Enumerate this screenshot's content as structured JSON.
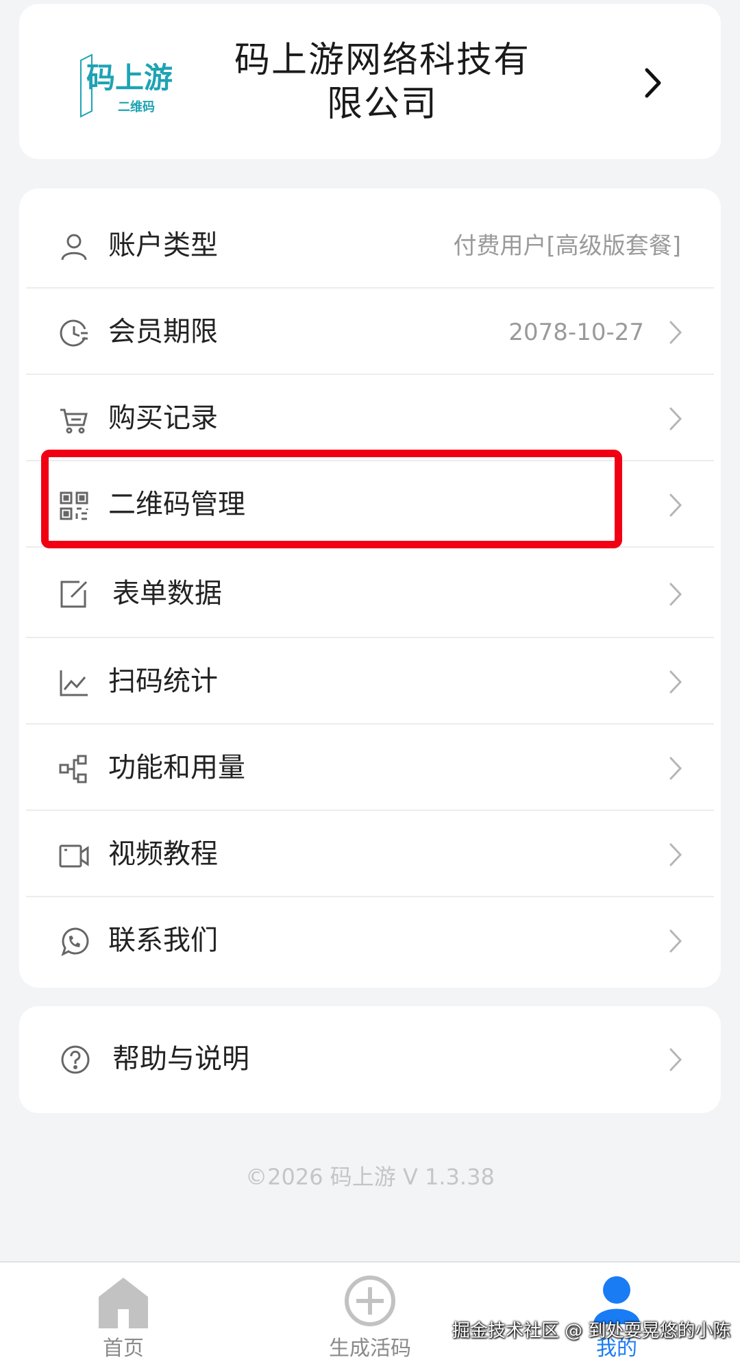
{
  "company": {
    "logo_text": "码上游",
    "logo_subtext": "二维码",
    "name_line1": "码上游网络科技有",
    "name_line2": "限公司"
  },
  "menu": [
    {
      "id": "account-type",
      "icon": "user-icon",
      "label": "账户类型",
      "value": "付费用户[高级版套餐]",
      "chevron": false
    },
    {
      "id": "membership",
      "icon": "clock-icon",
      "label": "会员期限",
      "value": "2078-10-27",
      "chevron": true
    },
    {
      "id": "purchases",
      "icon": "cart-icon",
      "label": "购买记录",
      "value": "",
      "chevron": true
    },
    {
      "id": "qrcode-manage",
      "icon": "qrcode-icon",
      "label": "二维码管理",
      "value": "",
      "chevron": true
    },
    {
      "id": "form-data",
      "icon": "edit-icon",
      "label": "表单数据",
      "value": "",
      "chevron": true
    },
    {
      "id": "scan-stats",
      "icon": "chart-icon",
      "label": "扫码统计",
      "value": "",
      "chevron": true
    },
    {
      "id": "features",
      "icon": "diagram-icon",
      "label": "功能和用量",
      "value": "",
      "chevron": true
    },
    {
      "id": "tutorials",
      "icon": "video-icon",
      "label": "视频教程",
      "value": "",
      "chevron": true
    },
    {
      "id": "contact",
      "icon": "whatsapp-icon",
      "label": "联系我们",
      "value": "",
      "chevron": true
    }
  ],
  "help": {
    "icon": "question-icon",
    "label": "帮助与说明"
  },
  "footer": "©2026 码上游 V 1.3.38",
  "tabs": [
    {
      "id": "home",
      "icon": "home-icon",
      "label": "首页",
      "active": false
    },
    {
      "id": "create",
      "icon": "plus-circle-icon",
      "label": "生成活码",
      "active": false
    },
    {
      "id": "mine",
      "icon": "person-icon",
      "label": "我的",
      "active": true
    }
  ],
  "watermark": "掘金技术社区 @ 到处耍晃悠的小陈",
  "colors": {
    "accent": "#1a7cf5",
    "highlight": "#f00012",
    "logo": "#1ea3b4"
  }
}
